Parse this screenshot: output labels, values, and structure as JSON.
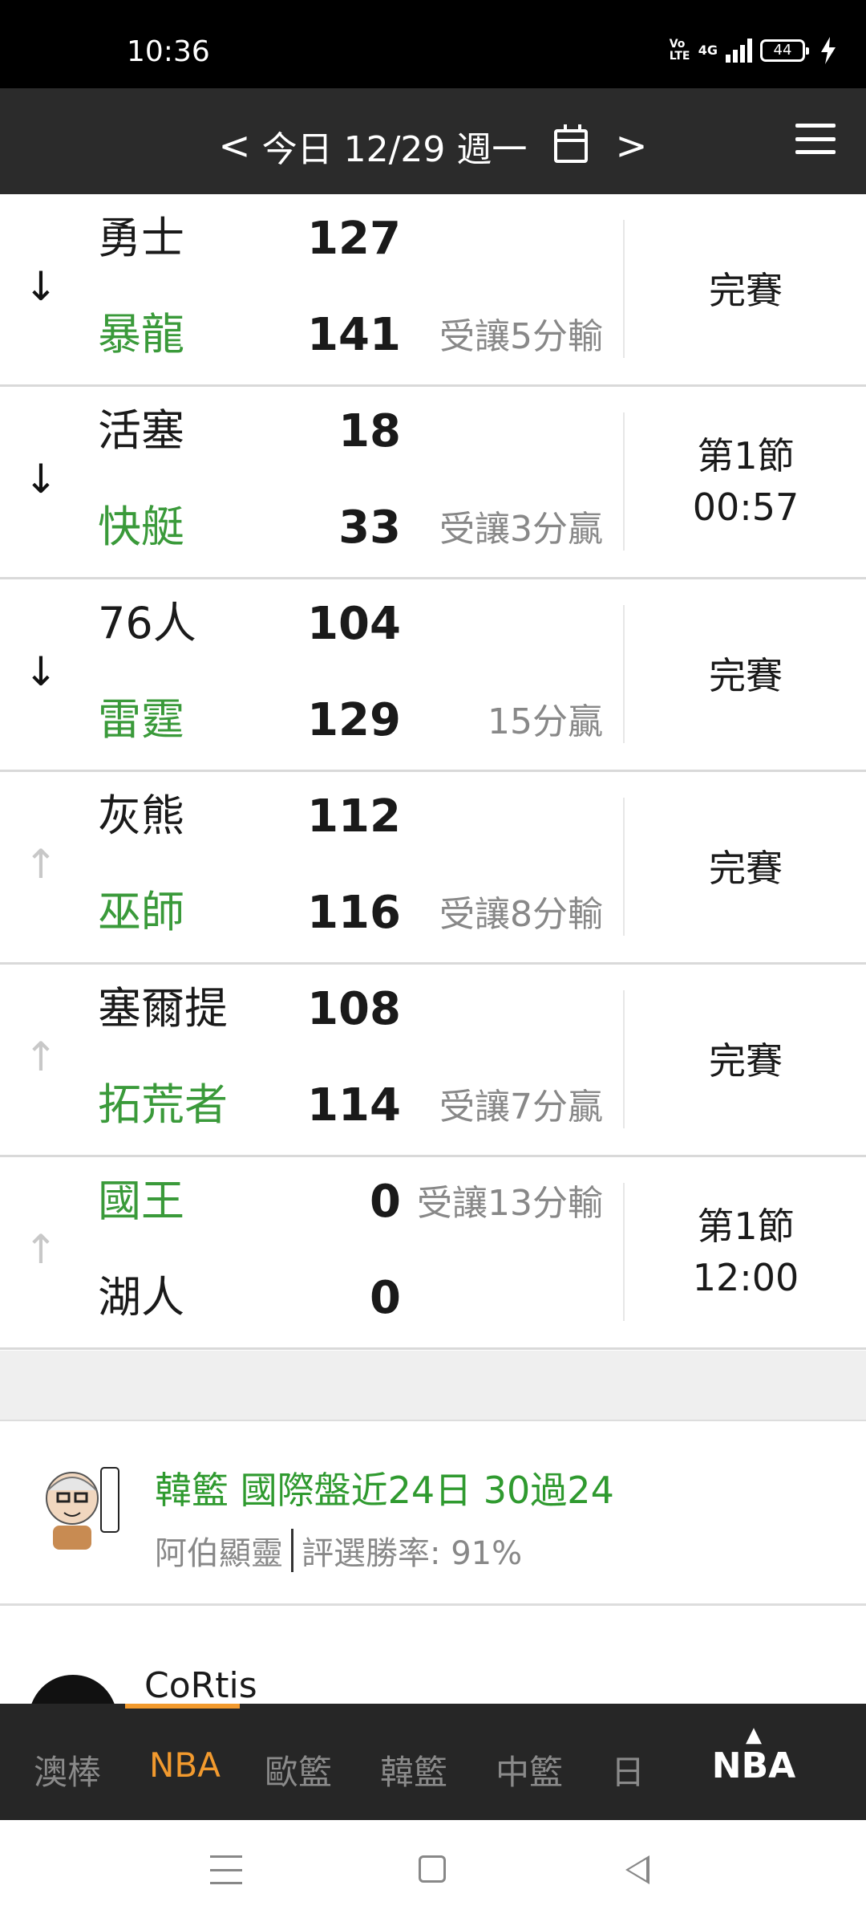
{
  "status_bar": {
    "time": "10:36",
    "network": "4G",
    "volte": "Vo LTE",
    "battery": "44"
  },
  "header": {
    "prev": "<",
    "date_label": "今日 12/29 週一",
    "next": ">"
  },
  "games": [
    {
      "team1": "勇士",
      "team1_color": "black",
      "score1": "127",
      "odds1": "",
      "team2": "暴龍",
      "team2_color": "green",
      "score2": "141",
      "odds2": "受讓5分輸",
      "status_line1": "完賽",
      "status_line2": "",
      "expand": "↓"
    },
    {
      "team1": "活塞",
      "team1_color": "black",
      "score1": "18",
      "odds1": "",
      "team2": "快艇",
      "team2_color": "green",
      "score2": "33",
      "odds2": "受讓3分贏",
      "status_line1": "第1節",
      "status_line2": "00:57",
      "expand": "↓"
    },
    {
      "team1": "76人",
      "team1_color": "black",
      "score1": "104",
      "odds1": "",
      "team2": "雷霆",
      "team2_color": "green",
      "score2": "129",
      "odds2": "15分贏",
      "status_line1": "完賽",
      "status_line2": "",
      "expand": "↓"
    },
    {
      "team1": "灰熊",
      "team1_color": "black",
      "score1": "112",
      "odds1": "",
      "team2": "巫師",
      "team2_color": "green",
      "score2": "116",
      "odds2": "受讓8分輸",
      "status_line1": "完賽",
      "status_line2": "",
      "expand": "↑"
    },
    {
      "team1": "塞爾提",
      "team1_color": "black",
      "score1": "108",
      "odds1": "",
      "team2": "拓荒者",
      "team2_color": "green",
      "score2": "114",
      "odds2": "受讓7分贏",
      "status_line1": "完賽",
      "status_line2": "",
      "expand": "↑"
    },
    {
      "team1": "國王",
      "team1_color": "green",
      "score1": "0",
      "odds1": "受讓13分輸",
      "team2": "湖人",
      "team2_color": "black",
      "score2": "0",
      "odds2": "",
      "status_line1": "第1節",
      "status_line2": "12:00",
      "expand": "↑"
    }
  ],
  "promo": {
    "title": "韓籃 國際盤近24日 30過24",
    "author": "阿伯顯靈",
    "win_rate": "評選勝率: 91%"
  },
  "comment": {
    "username": "CoRtis"
  },
  "tabs": [
    {
      "label": "澳棒",
      "active": false
    },
    {
      "label": "NBA",
      "active": true
    },
    {
      "label": "歐籃",
      "active": false
    },
    {
      "label": "韓籃",
      "active": false
    },
    {
      "label": "中籃",
      "active": false
    },
    {
      "label": "日",
      "active": false
    }
  ],
  "tab_right": {
    "caret": "▲",
    "label": "NBA"
  },
  "colors": {
    "green": "#3a9a3a",
    "orange": "#f29a2e",
    "header_bg": "#2b2b2b",
    "tabbar_bg": "#262626"
  }
}
